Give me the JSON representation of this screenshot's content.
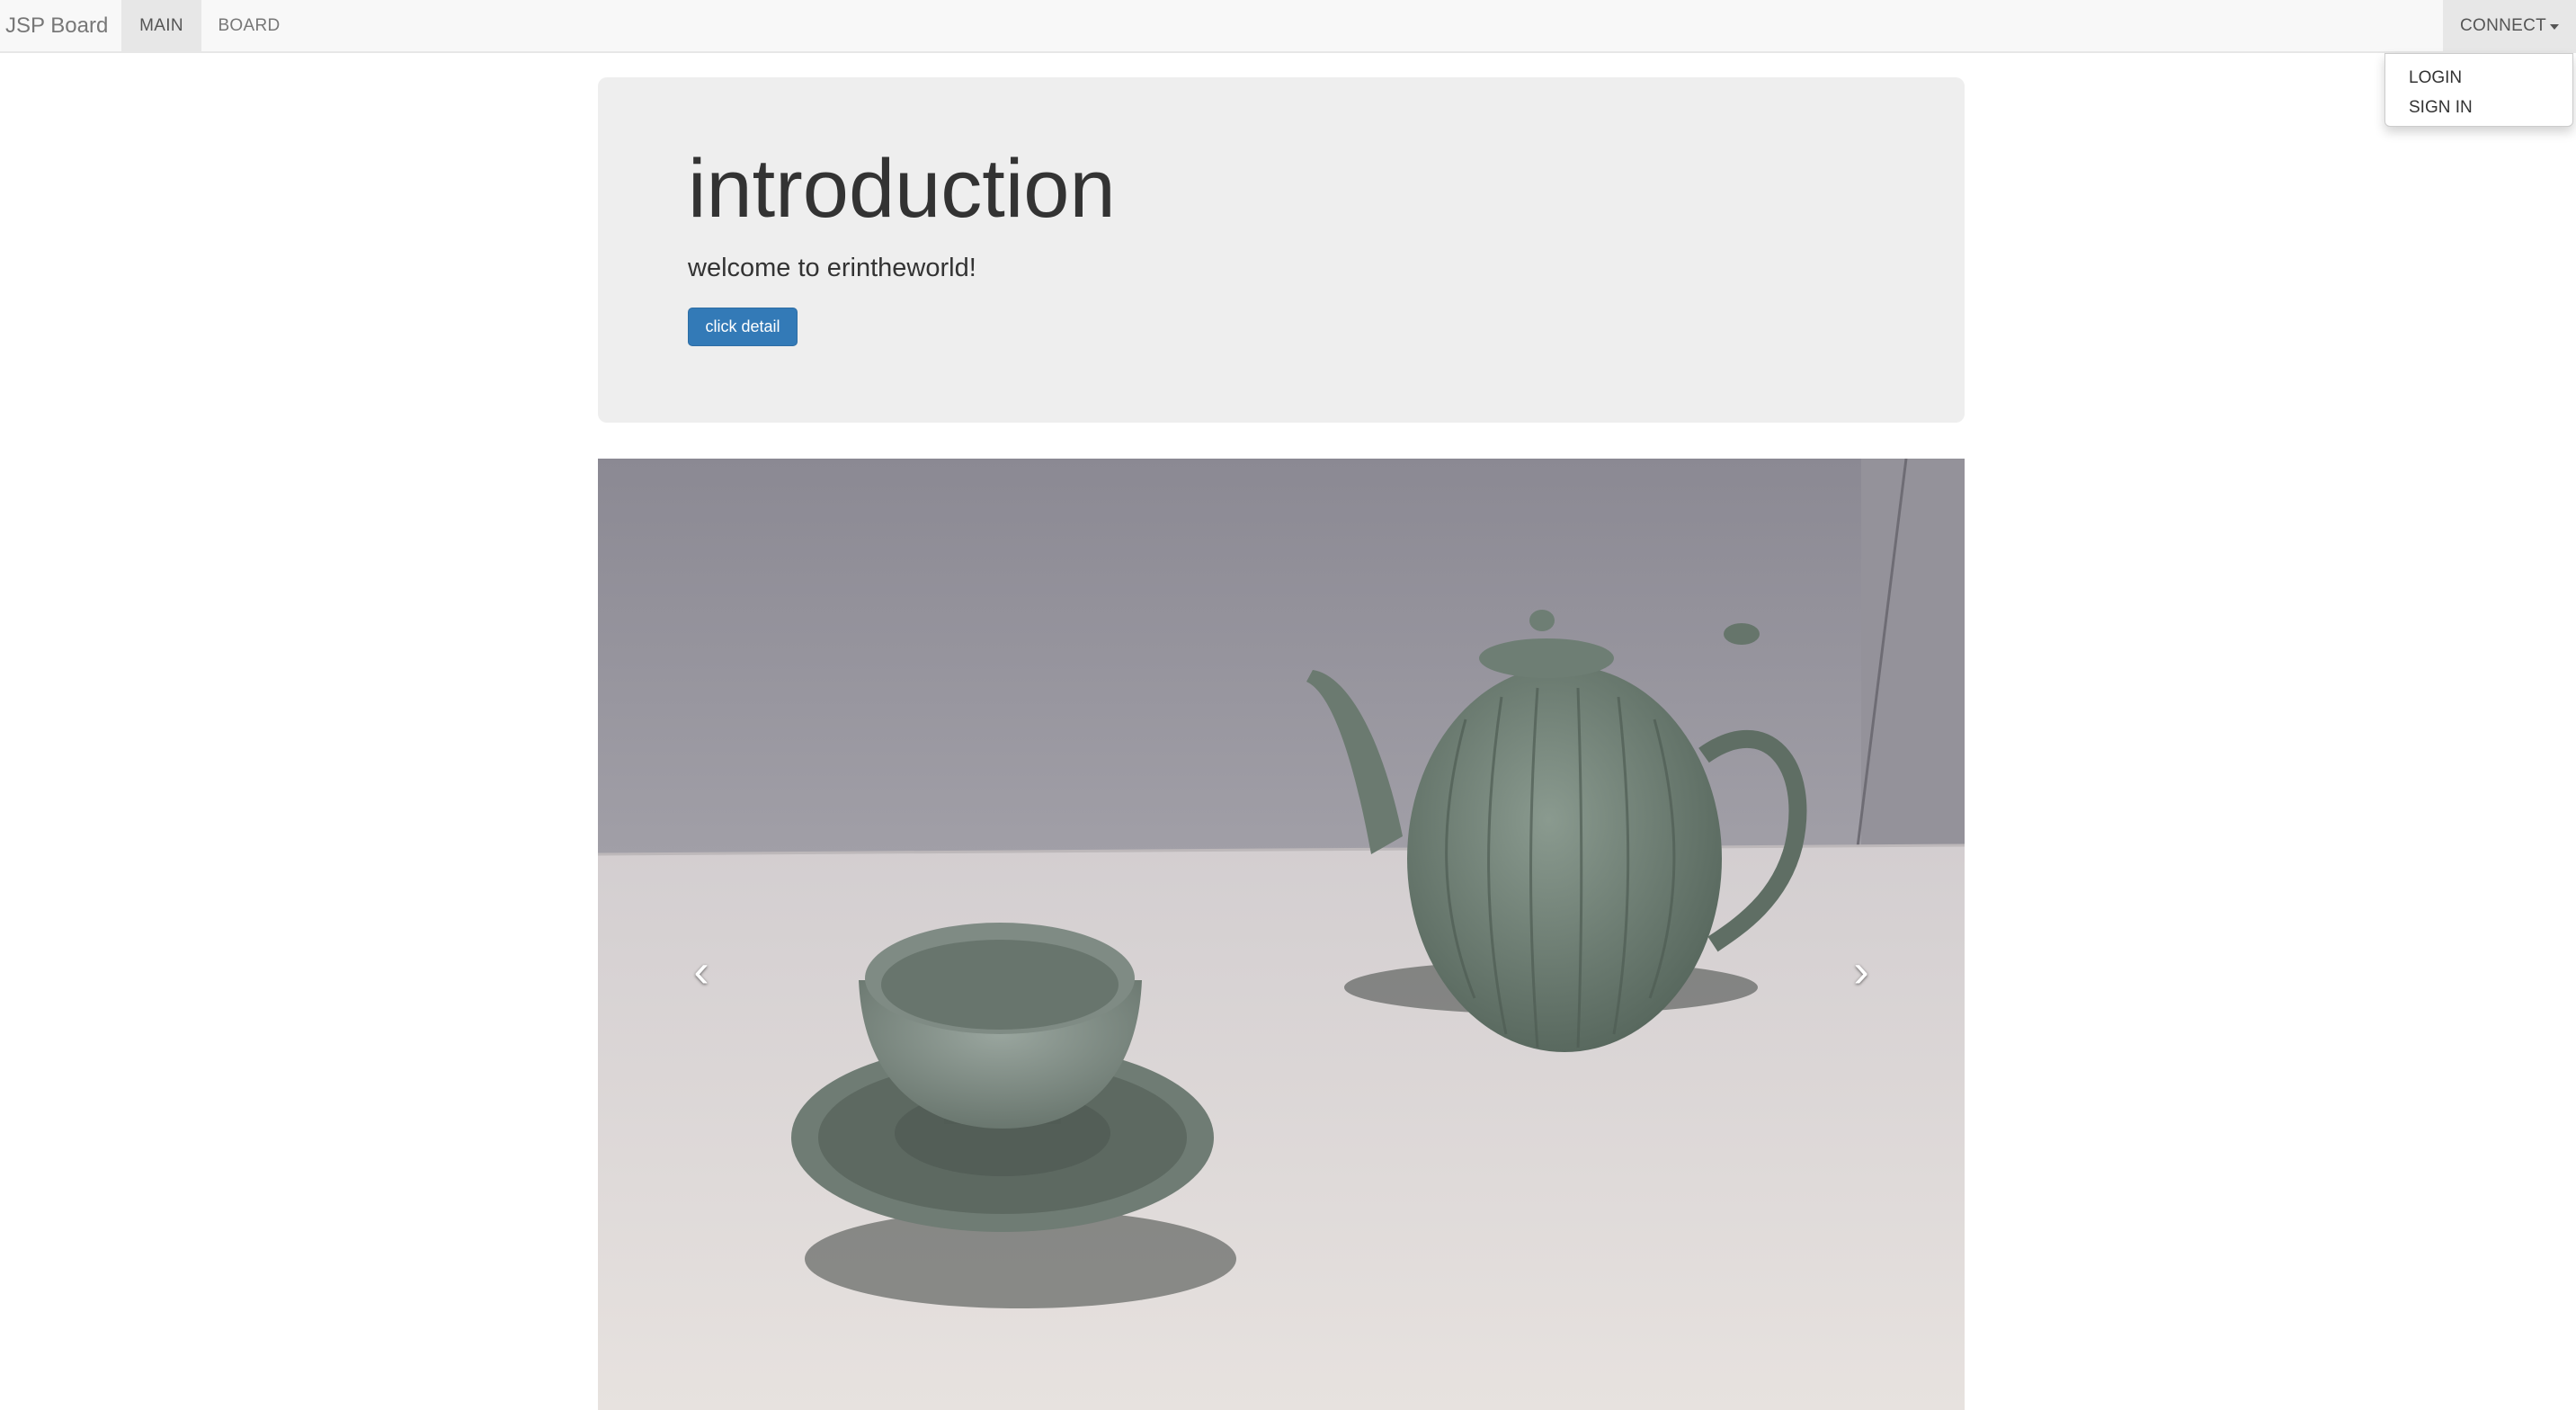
{
  "navbar": {
    "brand": "JSP Board",
    "items": [
      {
        "label": "MAIN",
        "active": true
      },
      {
        "label": "BOARD",
        "active": false
      }
    ],
    "connect_label": "CONNECT"
  },
  "dropdown": {
    "items": [
      {
        "label": "LOGIN"
      },
      {
        "label": "SIGN IN"
      }
    ]
  },
  "jumbotron": {
    "title": "introduction",
    "subtitle": "welcome to erintheworld!",
    "button_label": "click detail"
  },
  "carousel": {
    "prev_icon": "chevron-left-icon",
    "next_icon": "chevron-right-icon"
  },
  "colors": {
    "navbar_bg": "#f8f8f8",
    "jumbotron_bg": "#eeeeee",
    "primary": "#337ab7"
  }
}
